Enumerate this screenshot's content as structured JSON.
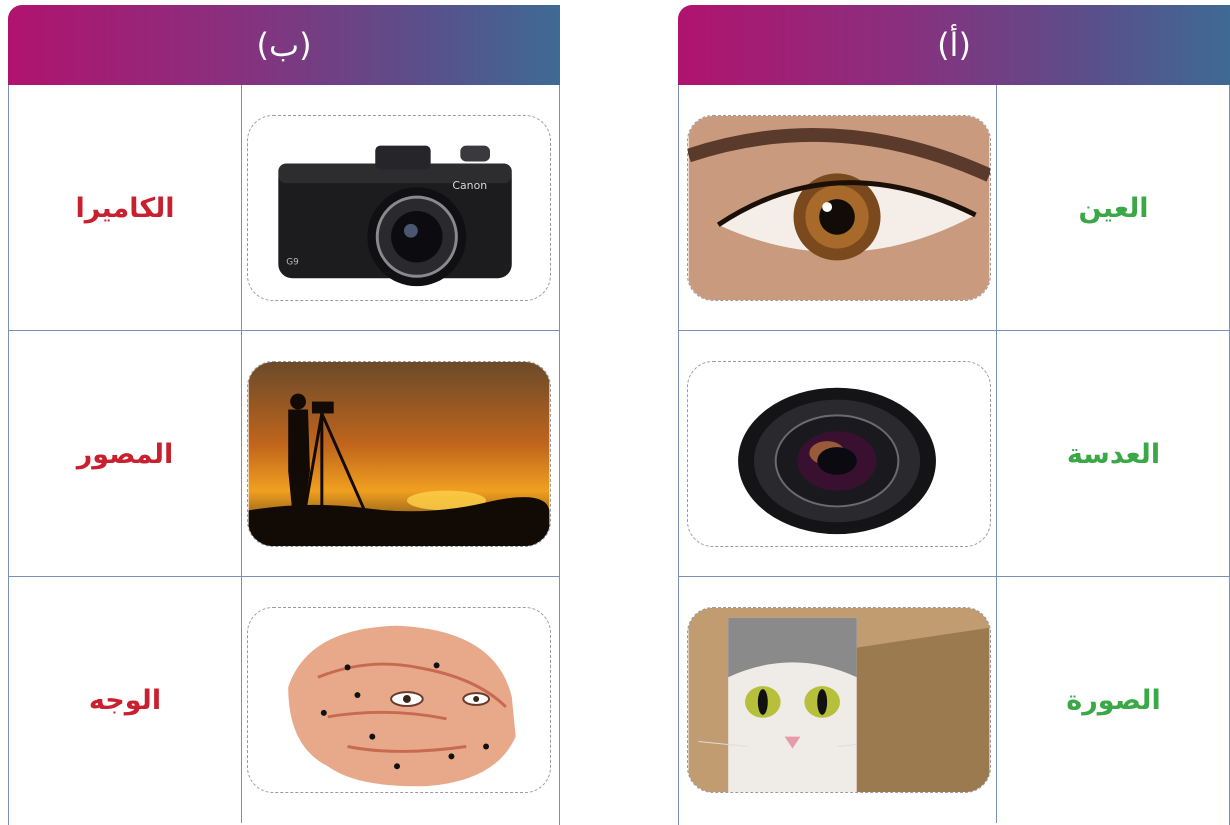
{
  "columns": {
    "b": {
      "header": "(ب)",
      "rows": [
        {
          "word": "الكاميرا",
          "image": "camera-image"
        },
        {
          "word": "المصور",
          "image": "photographer-image"
        },
        {
          "word": "الوجه",
          "image": "face-image"
        }
      ]
    },
    "a": {
      "header": "(أ)",
      "rows": [
        {
          "word": "العين",
          "image": "eye-image"
        },
        {
          "word": "العدسة",
          "image": "lens-image"
        },
        {
          "word": "الصورة",
          "image": "cat-picture-image"
        }
      ]
    }
  },
  "colors": {
    "column_b_words": "#c8202e",
    "column_a_words": "#3aa846",
    "header_gradient_start": "#b0136f",
    "header_gradient_end": "#3e6a93"
  }
}
